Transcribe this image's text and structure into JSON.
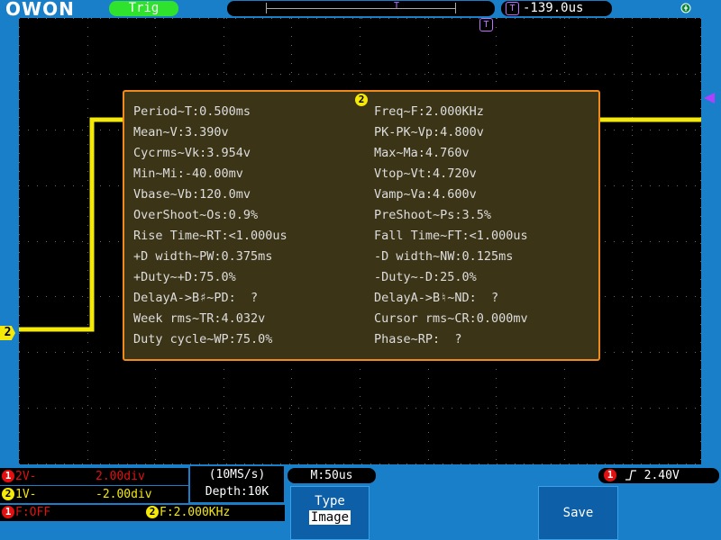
{
  "topbar": {
    "logo": "OWON",
    "trig_status": "Trig",
    "hpos_marker": "T",
    "time_offset": "-139.0us",
    "memory_marker": "T"
  },
  "screen": {
    "ch2_marker": "2",
    "trig_marker": "T",
    "trace_color": "#f5e90a",
    "panel_badge": "2"
  },
  "measurements": {
    "left": [
      "Period~T:0.500ms",
      "Mean~V:3.390v",
      "Cycrms~Vk:3.954v",
      "Min~Mi:-40.00mv",
      "Vbase~Vb:120.0mv",
      "OverShoot~Os:0.9%",
      "Rise Time~RT:<1.000us",
      "+D width~PW:0.375ms",
      "+Duty~+D:75.0%",
      "DelayA->B♯~PD:  ?",
      "Week rms~TR:4.032v",
      "Duty cycle~WP:75.0%"
    ],
    "right": [
      "Freq~F:2.000KHz",
      "PK-PK~Vp:4.800v",
      "Max~Ma:4.760v",
      "Vtop~Vt:4.720v",
      "Vamp~Va:4.600v",
      "PreShoot~Ps:3.5%",
      "Fall Time~FT:<1.000us",
      "-D width~NW:0.125ms",
      "-Duty~-D:25.0%",
      "DelayA->B♮~ND:  ?",
      "Cursor rms~CR:0.000mv",
      "Phase~RP:  ?"
    ]
  },
  "channels": {
    "ch1": {
      "num": "1",
      "scale": "2V-",
      "pos": "2.00div",
      "color": "#e21010"
    },
    "ch2": {
      "num": "2",
      "scale": "1V-",
      "pos": "-2.00div",
      "color": "#f5e90a"
    }
  },
  "acquisition": {
    "rate": "(10MS/s)",
    "depth": "Depth:10K"
  },
  "timebase": {
    "label": "M:50us"
  },
  "trigger": {
    "num": "1",
    "level": "2.40V",
    "edge_icon": "rising-edge"
  },
  "freq_row": {
    "ch1_num": "1",
    "ch1_text": "F:OFF",
    "ch2_num": "2",
    "ch2_text": "F:2.000KHz"
  },
  "menu": {
    "type_label": "Type",
    "type_value": "Image",
    "save_label": "Save"
  },
  "colors": {
    "body_blue": "#1a7fc9",
    "panel_border": "#f08a1a",
    "panel_bg": "#3b3417",
    "trig_green": "#2ee22e"
  }
}
